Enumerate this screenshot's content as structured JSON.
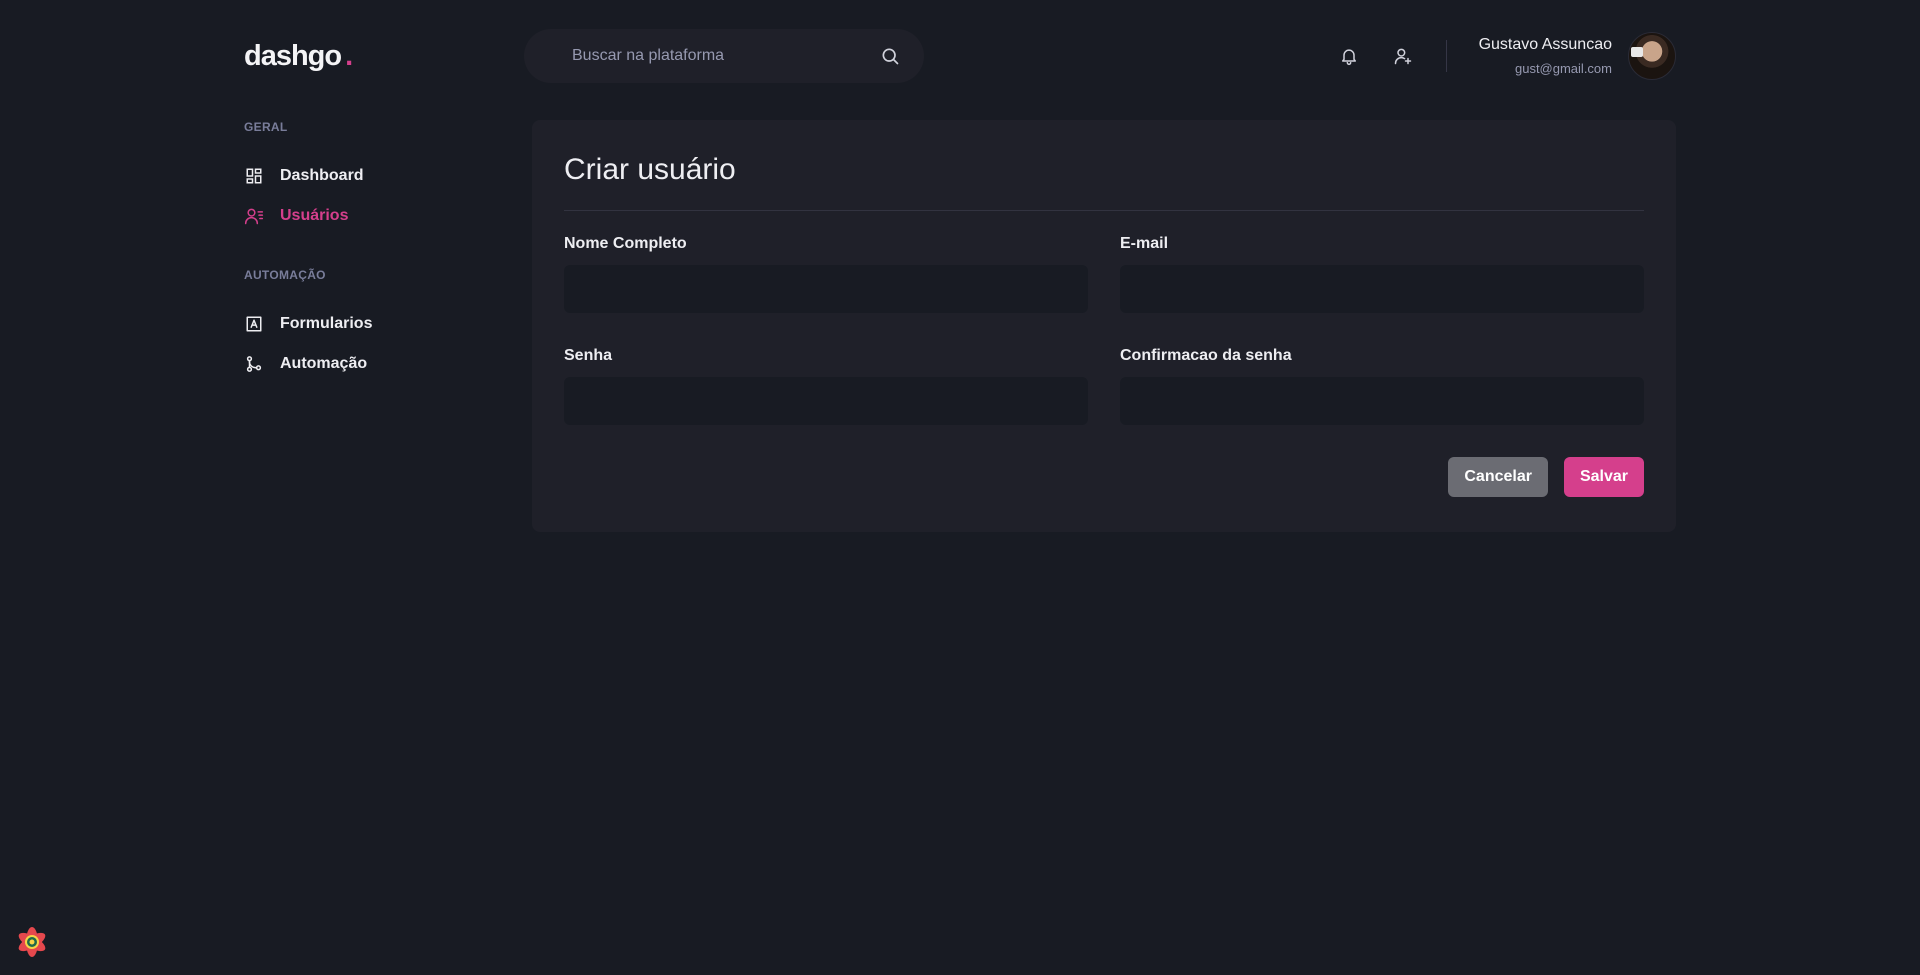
{
  "header": {
    "logo_text": "dashgo",
    "logo_dot": ".",
    "search_placeholder": "Buscar na plataforma",
    "user": {
      "name": "Gustavo Assuncao",
      "email": "gust@gmail.com"
    }
  },
  "sidebar": {
    "sections": [
      {
        "title": "GERAL",
        "items": [
          {
            "label": "Dashboard",
            "icon": "dashboard-icon",
            "active": false
          },
          {
            "label": "Usuários",
            "icon": "users-icon",
            "active": true
          }
        ]
      },
      {
        "title": "AUTOMAÇÃO",
        "items": [
          {
            "label": "Formularios",
            "icon": "form-icon",
            "active": false
          },
          {
            "label": "Automação",
            "icon": "git-merge-icon",
            "active": false
          }
        ]
      }
    ]
  },
  "form": {
    "title": "Criar usuário",
    "fields": [
      {
        "label": "Nome Completo",
        "value": ""
      },
      {
        "label": "E-mail",
        "value": ""
      },
      {
        "label": "Senha",
        "value": ""
      },
      {
        "label": "Confirmacao da senha",
        "value": ""
      }
    ],
    "cancel_label": "Cancelar",
    "save_label": "Salvar"
  },
  "colors": {
    "background": "#181b23",
    "card": "#1f2029",
    "accent": "#d53f8c",
    "muted": "#797d9a"
  }
}
